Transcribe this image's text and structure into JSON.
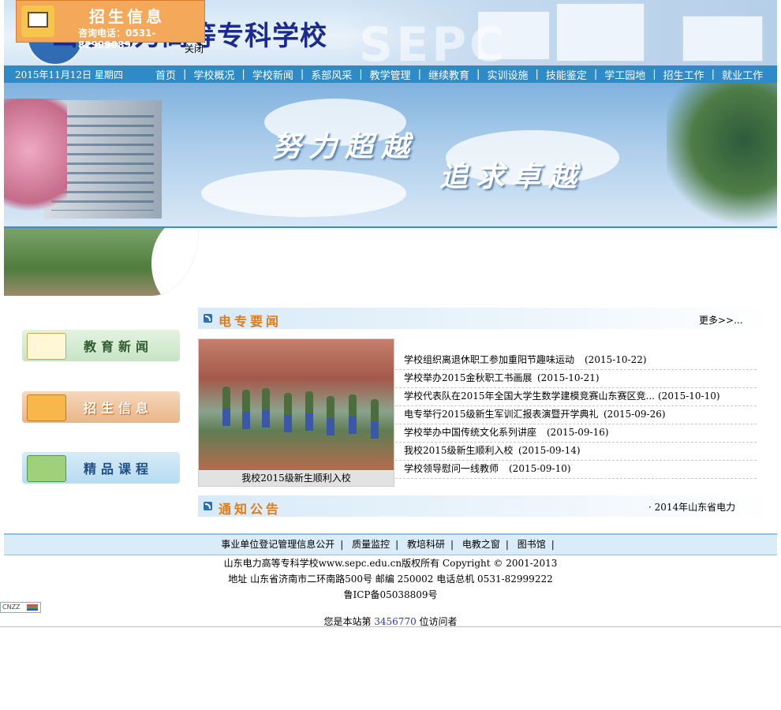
{
  "header": {
    "school_name": "山东电力高等专科学校",
    "watermark": "SEPC",
    "ad": {
      "title": "招生信息",
      "phone": "咨询电话：0531-82999089",
      "close": "关闭"
    }
  },
  "nav": {
    "date": "2015年11月12日  星期四",
    "items": [
      "首页",
      "学校概况",
      "学校新闻",
      "系部风采",
      "教学管理",
      "继续教育",
      "实训设施",
      "技能鉴定",
      "学工园地",
      "招生工作",
      "就业工作"
    ]
  },
  "banner": {
    "slogan1": "努力超越",
    "slogan2": "追求卓越"
  },
  "sidebar": {
    "buttons": [
      "教育新闻",
      "招生信息",
      "精品课程"
    ]
  },
  "news": {
    "title": "电专要闻",
    "more": "更多>>...",
    "photo_caption": "我校2015级新生顺利入校",
    "items": [
      {
        "title": "学校组织离退休职工参加重阳节趣味运动",
        "date": "(2015-10-22)"
      },
      {
        "title": "学校举办2015金秋职工书画展",
        "date": "(2015-10-21)"
      },
      {
        "title": "学校代表队在2015年全国大学生数学建模竞赛山东赛区竞...",
        "date": "(2015-10-10)"
      },
      {
        "title": "电专举行2015级新生军训汇报表演暨开学典礼",
        "date": "(2015-09-26)"
      },
      {
        "title": "学校举办中国传统文化系列讲座",
        "date": "(2015-09-16)"
      },
      {
        "title": "我校2015级新生顺利入校",
        "date": "(2015-09-14)"
      },
      {
        "title": "学校领导慰问一线教师",
        "date": "(2015-09-10)"
      }
    ]
  },
  "notice": {
    "title": "通知公告",
    "scroll_text": "· 2014年山东省电力"
  },
  "footer": {
    "links": [
      "事业单位登记管理信息公开",
      "质量监控",
      "教培科研",
      "电教之窗",
      "图书馆"
    ],
    "copyright": "山东电力高等专科学校www.sepc.edu.cn版权所有  Copyright © 2001-2013",
    "address": "地址  山东省济南市二环南路500号  邮编  250002 电话总机  0531-82999222",
    "icp": "鲁ICP备05038809号",
    "cnzz": "CNZZ",
    "visitor_prefix": "您是本站第 ",
    "visitor_count": "3456770",
    "visitor_suffix": " 位访问者"
  },
  "colors": {
    "nav_bg": "#2f8ac8",
    "accent_orange": "#e07b17",
    "school_name": "#1b2a8f"
  }
}
